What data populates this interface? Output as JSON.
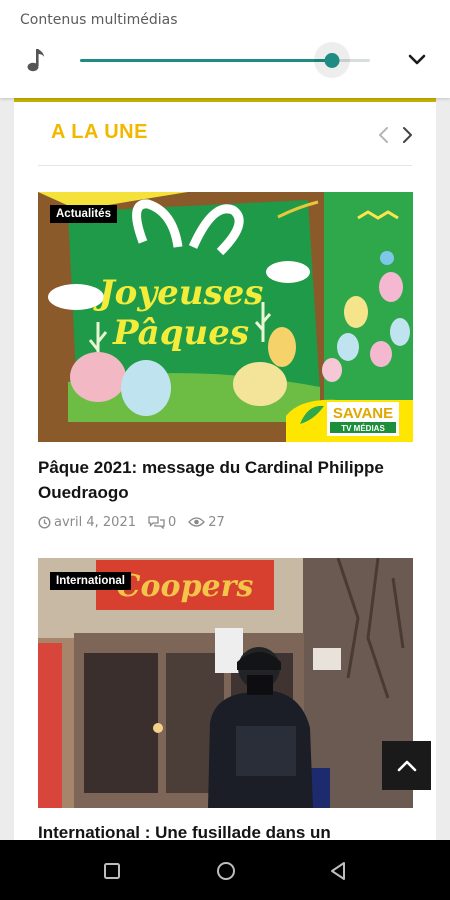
{
  "media_panel": {
    "title": "Contenus multimédias",
    "icons": {
      "media": "music-note-icon",
      "collapse": "chevron-down-icon"
    },
    "volume_level": 0.87,
    "accent_color": "#1e8c82"
  },
  "section": {
    "title": "A LA UNE",
    "nav_icons": [
      "chevron-left-icon",
      "chevron-right-icon"
    ],
    "title_color": "#f2b800"
  },
  "articles": [
    {
      "category": "Actualités",
      "title": "Pâque 2021: message du Cardinal Philippe Ouedraogo",
      "date": "avril 4, 2021",
      "comments": "0",
      "views": "27",
      "image": {
        "greeting_line1": "Joyeuses",
        "greeting_line2": "Pâques",
        "brand_name": "SAVANE",
        "brand_sub": "TV MÉDIAS"
      }
    },
    {
      "category": "International",
      "title": "International : Une fusillade dans un",
      "image": {
        "store_sign": "Coopers"
      }
    }
  ],
  "scroll_top_icon": "chevron-up-icon",
  "system_nav": {
    "buttons": [
      "square-recents-icon",
      "circle-home-icon",
      "triangle-back-icon"
    ]
  }
}
